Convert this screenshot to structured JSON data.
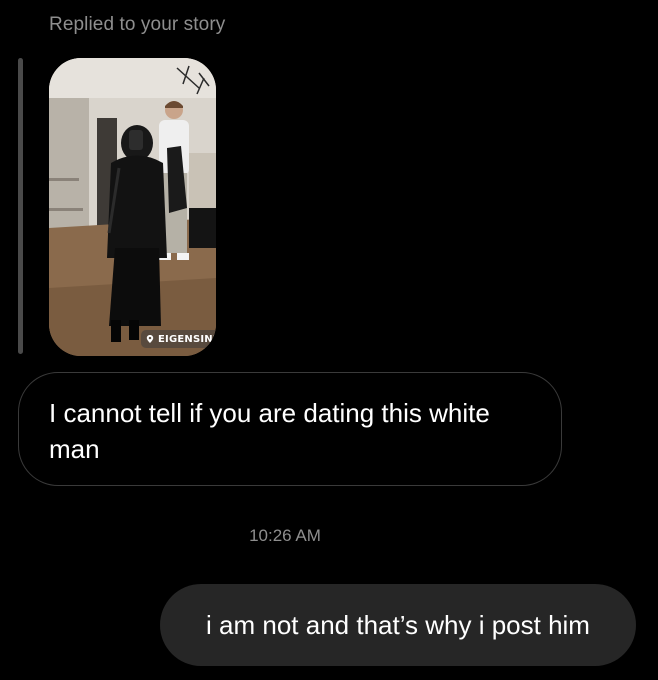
{
  "reply_header": {
    "label": "Replied to your story"
  },
  "story": {
    "location_sticker": "EIGENSINNIG",
    "pin_icon": "location-pin-icon"
  },
  "messages": [
    {
      "direction": "incoming",
      "text": "I cannot tell if you are dating this white man"
    },
    {
      "direction": "outgoing",
      "text": "i am not and that’s why i post him"
    }
  ],
  "timestamp": "10:26 AM",
  "colors": {
    "background": "#000000",
    "muted_text": "#8e8e8e",
    "incoming_border": "#3a3a3a",
    "outgoing_bubble": "#262626",
    "reply_bar": "#4a4a4a"
  }
}
